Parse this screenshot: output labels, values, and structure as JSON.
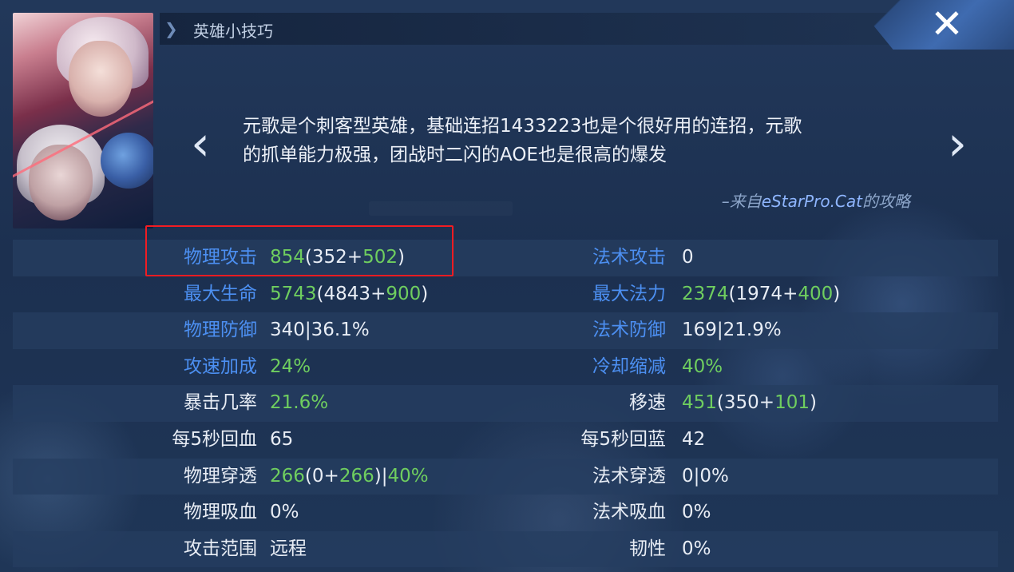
{
  "header": {
    "title": "英雄小技巧",
    "close_label": "✕"
  },
  "tip": {
    "line1": "元歌是个刺客型英雄，基础连招1433223也是个很好用的连招，元歌",
    "line2": "的抓单能力极强，团战时二闪的AOE也是很高的爆发",
    "source_prefix": "–来自",
    "source_brand": "eStarPro.Cat",
    "source_suffix": "的攻略",
    "prev_icon": "chevron-left-icon",
    "next_icon": "chevron-right-icon"
  },
  "stats": {
    "rows": [
      {
        "left_label": "物理攻击",
        "left_val": {
          "total": "854",
          "open": "(",
          "base": "352",
          "plus": "+",
          "bonus": "502",
          "close": ")"
        },
        "right_label": "法术攻击",
        "right_val": {
          "plain": "0"
        }
      },
      {
        "left_label": "最大生命",
        "left_val": {
          "total": "5743",
          "open": "(",
          "base": "4843",
          "plus": "+",
          "bonus": "900",
          "close": ")"
        },
        "right_label": "最大法力",
        "right_val": {
          "total": "2374",
          "open": "(",
          "base": "1974",
          "plus": "+",
          "bonus": "400",
          "close": ")"
        }
      },
      {
        "left_label": "物理防御",
        "left_val": {
          "plain": "340|36.1%"
        },
        "right_label": "法术防御",
        "right_val": {
          "plain": "169|21.9%"
        }
      },
      {
        "left_label": "攻速加成",
        "left_val": {
          "green": "24%"
        },
        "right_label": "冷却缩减",
        "right_val": {
          "green": "40%"
        }
      },
      {
        "left_label": "暴击几率",
        "left_val": {
          "green": "21.6%"
        },
        "right_label": "移速",
        "right_val": {
          "total": "451",
          "open": "(",
          "base": "350",
          "plus": "+",
          "bonus": "101",
          "close": ")"
        }
      },
      {
        "left_label": "每5秒回血",
        "left_val": {
          "plain": "65"
        },
        "right_label": "每5秒回蓝",
        "right_val": {
          "plain": "42"
        }
      },
      {
        "left_label": "物理穿透",
        "left_val": {
          "total": "266",
          "open": "(",
          "base": "0",
          "plus": "+",
          "bonus": "266",
          "close": ")",
          "sep": "|",
          "pct": "40%"
        },
        "right_label": "法术穿透",
        "right_val": {
          "plain": "0|0%"
        }
      },
      {
        "left_label": "物理吸血",
        "left_val": {
          "plain": "0%"
        },
        "right_label": "法术吸血",
        "right_val": {
          "plain": "0%"
        }
      },
      {
        "left_label": "攻击范围",
        "left_val": {
          "plain": "远程"
        },
        "right_label": "韧性",
        "right_val": {
          "plain": "0%"
        }
      }
    ]
  },
  "colors": {
    "label_blue": "#4c8ff1",
    "value_green": "#6fce5f",
    "highlight_red": "#f21c22"
  }
}
